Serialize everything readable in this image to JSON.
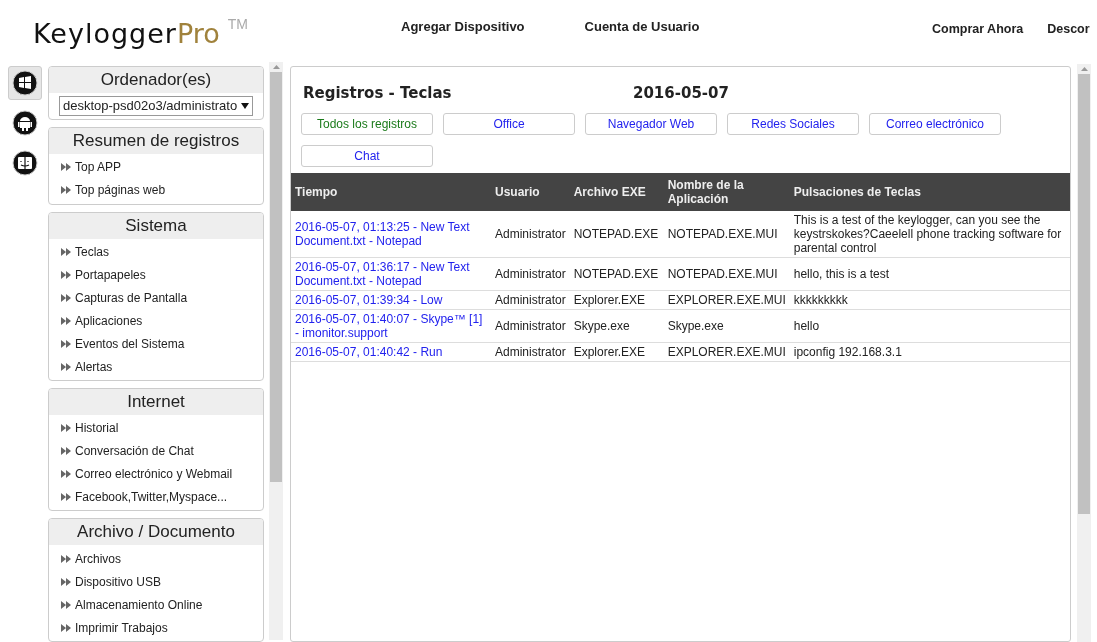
{
  "header": {
    "logo_main": "Keylogger",
    "logo_accent": "Pro",
    "logo_mark": "TM",
    "nav": [
      "Agregar Dispositivo",
      "Cuenta de Usuario"
    ],
    "nav_right": [
      "Comprar Ahora",
      "Descor"
    ]
  },
  "platforms": [
    {
      "kind": "windows",
      "selected": true
    },
    {
      "kind": "android",
      "selected": false
    },
    {
      "kind": "mac",
      "selected": false
    }
  ],
  "computer": {
    "title": "Ordenador(es)",
    "value": "desktop-psd02o3/administrato"
  },
  "sections": [
    {
      "title": "Resumen de registros",
      "items": [
        "Top APP",
        "Top páginas web"
      ]
    },
    {
      "title": "Sistema",
      "items": [
        "Teclas",
        "Portapapeles",
        "Capturas de Pantalla",
        "Aplicaciones",
        "Eventos del Sistema",
        "Alertas"
      ]
    },
    {
      "title": "Internet",
      "items": [
        "Historial",
        "Conversación de Chat",
        "Correo electrónico y Webmail",
        "Facebook,Twitter,Myspace..."
      ]
    },
    {
      "title": "Archivo / Documento",
      "items": [
        "Archivos",
        "Dispositivo USB",
        "Almacenamiento Online",
        "Imprimir Trabajos"
      ]
    }
  ],
  "main": {
    "title": "Registros - Teclas",
    "date": "2016-05-07",
    "filters": [
      {
        "label": "Todos los registros",
        "selected": true
      },
      {
        "label": "Office",
        "selected": false
      },
      {
        "label": "Navegador Web",
        "selected": false
      },
      {
        "label": "Redes Sociales",
        "selected": false
      },
      {
        "label": "Correo electrónico",
        "selected": false
      },
      {
        "label": "Chat",
        "selected": false
      }
    ],
    "table": {
      "columns": [
        "Tiempo",
        "Usuario",
        "Archivo EXE",
        "Nombre de la Aplicación",
        "Pulsaciones de Teclas"
      ],
      "rows": [
        [
          "2016-05-07, 01:13:25 - New Text Document.txt - Notepad",
          "Administrator",
          "NOTEPAD.EXE",
          "NOTEPAD.EXE.MUI",
          "This is a test of the keylogger, can you see the keystrskokes?Caeelell phone tracking software for parental control"
        ],
        [
          "2016-05-07, 01:36:17 - New Text Document.txt - Notepad",
          "Administrator",
          "NOTEPAD.EXE",
          "NOTEPAD.EXE.MUI",
          "hello, this is a test"
        ],
        [
          "2016-05-07, 01:39:34 - Low",
          "Administrator",
          "Explorer.EXE",
          "EXPLORER.EXE.MUI",
          "kkkkkkkkk"
        ],
        [
          "2016-05-07, 01:40:07 - Skype™ [1] - imonitor.support",
          "Administrator",
          "Skype.exe",
          "Skype.exe",
          "hello"
        ],
        [
          "2016-05-07, 01:40:42 - Run",
          "Administrator",
          "Explorer.EXE",
          "EXPLORER.EXE.MUI",
          "ipconfig 192.168.3.1"
        ]
      ]
    }
  }
}
